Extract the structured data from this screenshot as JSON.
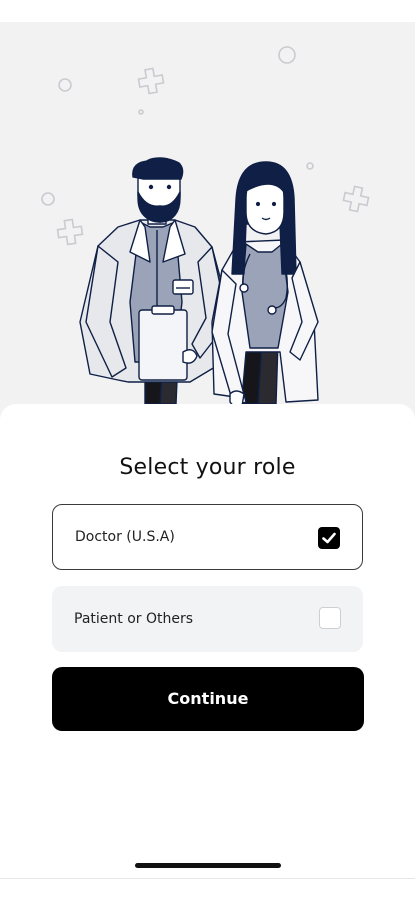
{
  "title": "Select your role",
  "options": [
    {
      "label": "Doctor (U.S.A)",
      "selected": true
    },
    {
      "label": "Patient or Others",
      "selected": false
    }
  ],
  "continue_label": "Continue",
  "colors": {
    "hero_background": "#f2f2f3",
    "primary": "#000000",
    "illustration_navy": "#0f1f45",
    "unselected_option": "#f2f3f5"
  },
  "icons": {
    "illustration": "doctors-illustration",
    "checked": "checkbox-checked-icon",
    "unchecked": "checkbox-empty-icon"
  }
}
